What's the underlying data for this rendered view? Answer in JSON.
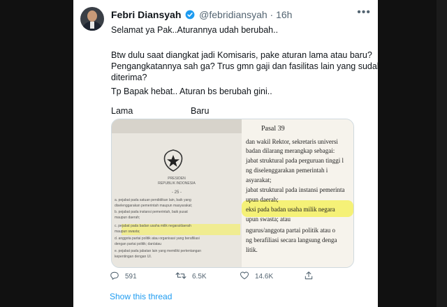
{
  "tweet": {
    "author_name": "Febri Diansyah",
    "handle": "@febridiansyah",
    "separator": "·",
    "time": "16h",
    "lines": [
      "Selamat ya Pak..Aturannya udah berubah..",
      "Btw dulu saat diangkat jadi Komisaris, pake aturan lama atau baru?",
      "Pengangkatannya sah ga? Trus gmn gaji dan fasilitas lain yang sudah pernah",
      "diterima?",
      "Tp Bapak hebat.. Aturan bs berubah gini.."
    ],
    "label_old": "Lama",
    "label_new": "Baru"
  },
  "image": {
    "left_doc": {
      "caption_1": "PRESIDEN",
      "caption_2": "REPUBLIK INDONESIA",
      "page": "- 25 -",
      "items": [
        "a.   pejabat pada satuan pendidikan lain, baik yang",
        "      diselenggarakan pemerintah maupun masyarakat;",
        "b.   pejabat pada instansi pemerintah, baik pusat",
        "      maupun daerah;",
        "c.   pejabat pada badan usaha milik negara/daerah",
        "      maupun swasta;",
        "d.   anggota partai politik atau organisasi yang berafiliasi",
        "      dengan partai politik; dan/atau",
        "e.   pejabat pada jabatan lain yang memiliki pertentangan",
        "      kepentingan dengan UI."
      ]
    },
    "right_doc": {
      "title": "Pasal 39",
      "lines": [
        "dan wakil Rektor, sekretaris universi",
        "badan dilarang merangkap sebagai:",
        "jabat struktural pada perguruan tinggi l",
        "ng    diselenggarakan    pemerintah    i",
        "asyarakat;",
        "jabat struktural pada instansi pemerinta",
        "upun daerah;",
        "eksi pada badan usaha milik negara",
        "upun swasta; atau",
        "ngurus/anggota partai politik atau o",
        "ng berafiliasi secara langsung denga",
        "litik."
      ]
    }
  },
  "actions": {
    "replies": "591",
    "retweets": "6.5K",
    "likes": "14.6K"
  },
  "show_thread": "Show this thread",
  "colors": {
    "accent": "#1d9bf0",
    "text": "#0f1419",
    "muted": "#536471",
    "highlight": "#f5f050"
  }
}
